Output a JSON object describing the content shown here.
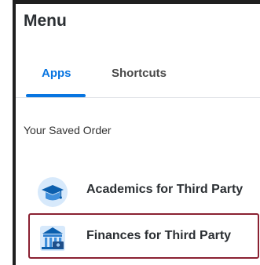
{
  "menu": {
    "title": "Menu",
    "tabs": [
      {
        "label": "Apps",
        "active": true
      },
      {
        "label": "Shortcuts",
        "active": false
      }
    ],
    "section_label": "Your Saved Order",
    "items": [
      {
        "label": "Academics for Third Party",
        "icon": "graduation-cap-icon",
        "selected": false
      },
      {
        "label": "Finances for Third Party",
        "icon": "bank-icon",
        "selected": true
      }
    ]
  },
  "colors": {
    "accent": "#0875e1",
    "selected_border": "#8a2132",
    "text": "#2b2f33"
  }
}
